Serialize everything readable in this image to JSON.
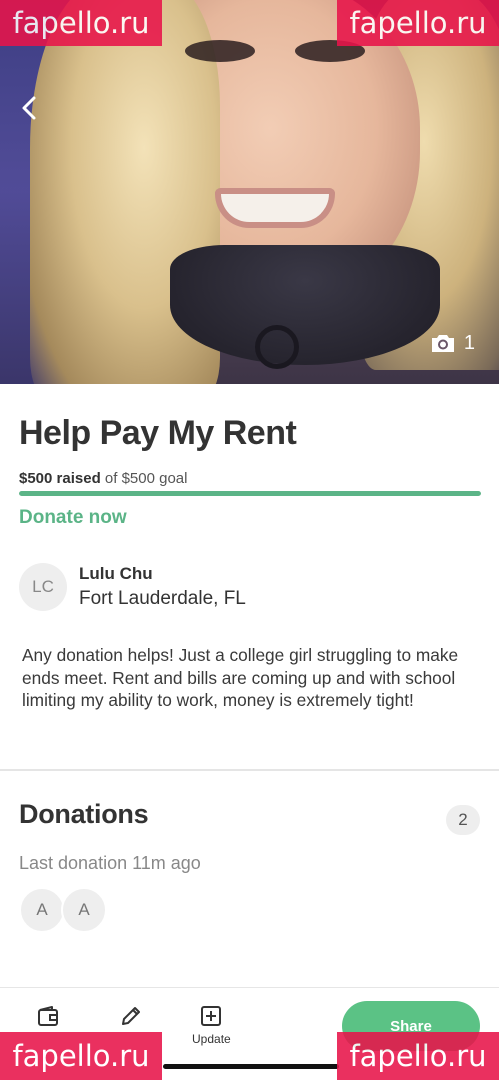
{
  "watermark": {
    "text": "fapello.ru"
  },
  "hero": {
    "back_icon": "chevron-left-icon",
    "camera_icon": "camera-icon",
    "photo_count": "1"
  },
  "campaign": {
    "title": "Help Pay My Rent",
    "raised_amount": "$500 raised",
    "goal_text": "of $500 goal",
    "progress_fraction": 1.0,
    "donate_label": "Donate now",
    "accent_color": "#5bb487"
  },
  "organizer": {
    "initials": "LC",
    "name": "Lulu Chu",
    "location": "Fort Lauderdale, FL"
  },
  "story": "Any donation helps! Just a college girl struggling to make ends meet. Rent and bills are coming up and with school limiting my ability to work, money is extremely tight!",
  "donations": {
    "title": "Donations",
    "count": "2",
    "last_donation": "Last donation 11m ago",
    "donors": [
      "A",
      "A"
    ]
  },
  "bottom_bar": {
    "wallet_icon": "wallet-icon",
    "edit_icon": "pencil-icon",
    "update_icon": "plus-square-icon",
    "update_label": "Update",
    "share_label": "Share",
    "share_color": "#5bc285"
  }
}
